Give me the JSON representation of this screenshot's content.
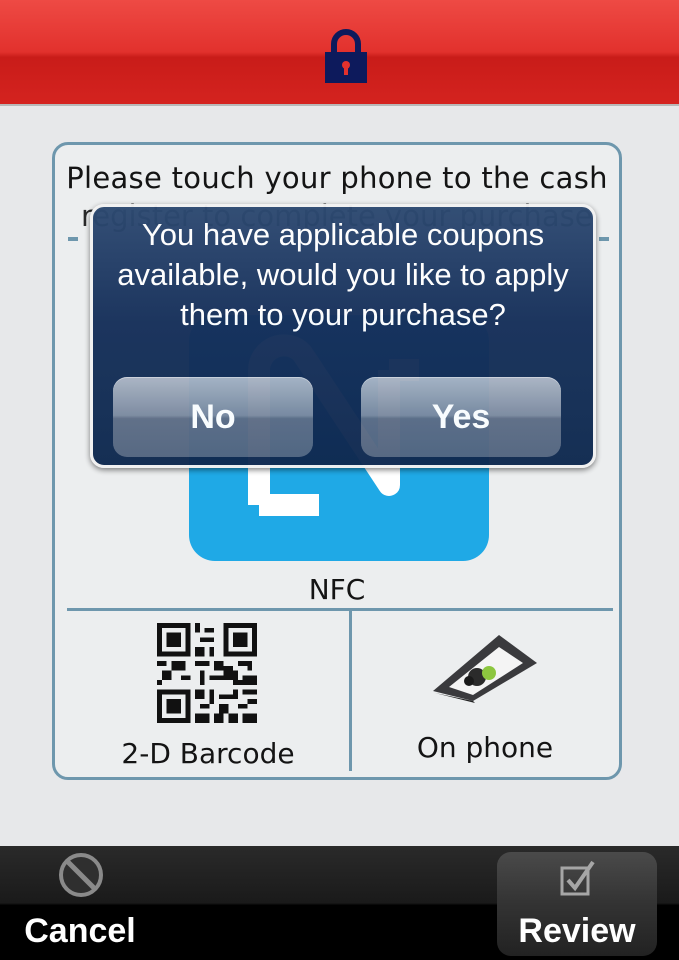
{
  "header": {
    "icon": "lock-icon"
  },
  "instruction": {
    "line1": "Please touch your phone to the cash",
    "line2": "register to complete your purchase"
  },
  "payment_options": {
    "nfc_label": "NFC",
    "barcode_label": "2-D Barcode",
    "phone_label": "On phone"
  },
  "modal": {
    "message": "You have applicable coupons available, would you like to apply them to your purchase?",
    "no_label": "No",
    "yes_label": "Yes"
  },
  "bottom_bar": {
    "cancel_label": "Cancel",
    "review_label": "Review",
    "cancel_icon": "no-entry-icon",
    "review_icon": "checkbox-icon"
  },
  "colors": {
    "header_red": "#e2312d",
    "nfc_blue": "#1fa9e6",
    "modal_navy": "#16305a",
    "card_border": "#6e97ad"
  }
}
